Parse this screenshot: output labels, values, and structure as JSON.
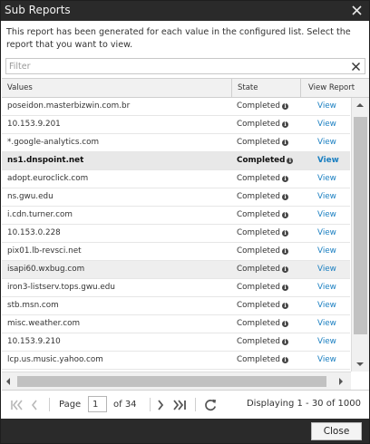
{
  "dialog": {
    "title": "Sub Reports",
    "description": "This report has been generated for each value in the configured list. Select the report that you want to view.",
    "filter_placeholder": "Filter",
    "close_label": "Close"
  },
  "table": {
    "columns": [
      "Values",
      "State",
      "View Report"
    ],
    "rows": [
      {
        "value": "poseidon.masterbizwin.com.br",
        "state": "Completed",
        "link": "View"
      },
      {
        "value": "10.153.9.201",
        "state": "Completed",
        "link": "View"
      },
      {
        "value": "*.google-analytics.com",
        "state": "Completed",
        "link": "View"
      },
      {
        "value": "ns1.dnspoint.net",
        "state": "Completed",
        "link": "View",
        "selected": true
      },
      {
        "value": "adopt.euroclick.com",
        "state": "Completed",
        "link": "View"
      },
      {
        "value": "ns.gwu.edu",
        "state": "Completed",
        "link": "View"
      },
      {
        "value": "i.cdn.turner.com",
        "state": "Completed",
        "link": "View"
      },
      {
        "value": "10.153.0.228",
        "state": "Completed",
        "link": "View"
      },
      {
        "value": "pix01.lb-revsci.net",
        "state": "Completed",
        "link": "View"
      },
      {
        "value": "isapi60.wxbug.com",
        "state": "Completed",
        "link": "View",
        "hover": true
      },
      {
        "value": "iron3-listserv.tops.gwu.edu",
        "state": "Completed",
        "link": "View"
      },
      {
        "value": "stb.msn.com",
        "state": "Completed",
        "link": "View"
      },
      {
        "value": "misc.weather.com",
        "state": "Completed",
        "link": "View"
      },
      {
        "value": "10.153.9.210",
        "state": "Completed",
        "link": "View"
      },
      {
        "value": "lcp.us.music.yahoo.com",
        "state": "Completed",
        "link": "View"
      }
    ]
  },
  "pager": {
    "page_label": "Page",
    "current_page": "1",
    "of_label": "of 34",
    "display_info": "Displaying 1 - 30 of 1000"
  },
  "icons": {
    "close": "close-icon",
    "clear": "clear-filter-icon",
    "info": "info-icon",
    "first": "first-page-icon",
    "prev": "prev-page-icon",
    "next": "next-page-icon",
    "last": "last-page-icon",
    "refresh": "refresh-icon"
  }
}
